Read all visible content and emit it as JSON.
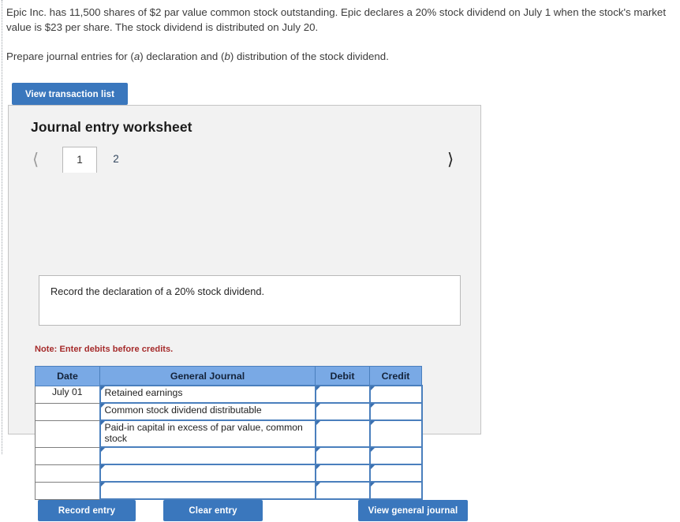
{
  "problem": {
    "paragraph_1_part_a": "Epic Inc. has 11,500 shares of $2 par value common stock outstanding. Epic declares a 20% stock dividend on July 1 when the stock's market value is $23 per share. The stock dividend is distributed on July 20.",
    "paragraph_2_lead": "Prepare journal entries for (",
    "paragraph_2_italic_a": "a",
    "paragraph_2_mid": ") declaration and (",
    "paragraph_2_italic_b": "b",
    "paragraph_2_tail": ") distribution of the stock dividend."
  },
  "toolbar": {
    "view_transaction_list_label": "View transaction list"
  },
  "worksheet": {
    "title": "Journal entry worksheet",
    "tabs": [
      {
        "label": "1",
        "selected": true
      },
      {
        "label": "2",
        "selected": false
      }
    ],
    "prev_icon": "chevron-left-icon",
    "next_icon": "chevron-right-icon",
    "instruction": "Record the declaration of a 20% stock dividend.",
    "note": "Note: Enter debits before credits."
  },
  "journal": {
    "columns": [
      "Date",
      "General Journal",
      "Debit",
      "Credit"
    ],
    "rows": [
      {
        "date": "July 01",
        "account": "Retained earnings",
        "debit": "",
        "credit": ""
      },
      {
        "date": "",
        "account": "Common stock dividend distributable",
        "debit": "",
        "credit": ""
      },
      {
        "date": "",
        "account": "Paid-in capital in excess of par value, common stock",
        "debit": "",
        "credit": ""
      },
      {
        "date": "",
        "account": "",
        "debit": "",
        "credit": ""
      },
      {
        "date": "",
        "account": "",
        "debit": "",
        "credit": ""
      },
      {
        "date": "",
        "account": "",
        "debit": "",
        "credit": ""
      }
    ]
  },
  "footer": {
    "record_entry_label": "Record entry",
    "clear_entry_label": "Clear entry",
    "view_general_journal_label": "View general journal"
  },
  "colors": {
    "button_blue": "#3a77bd",
    "table_header_blue": "#79a9e5",
    "field_border_blue": "#4a7fbd",
    "note_red": "#a52a2a",
    "panel_gray": "#f2f2f2"
  }
}
